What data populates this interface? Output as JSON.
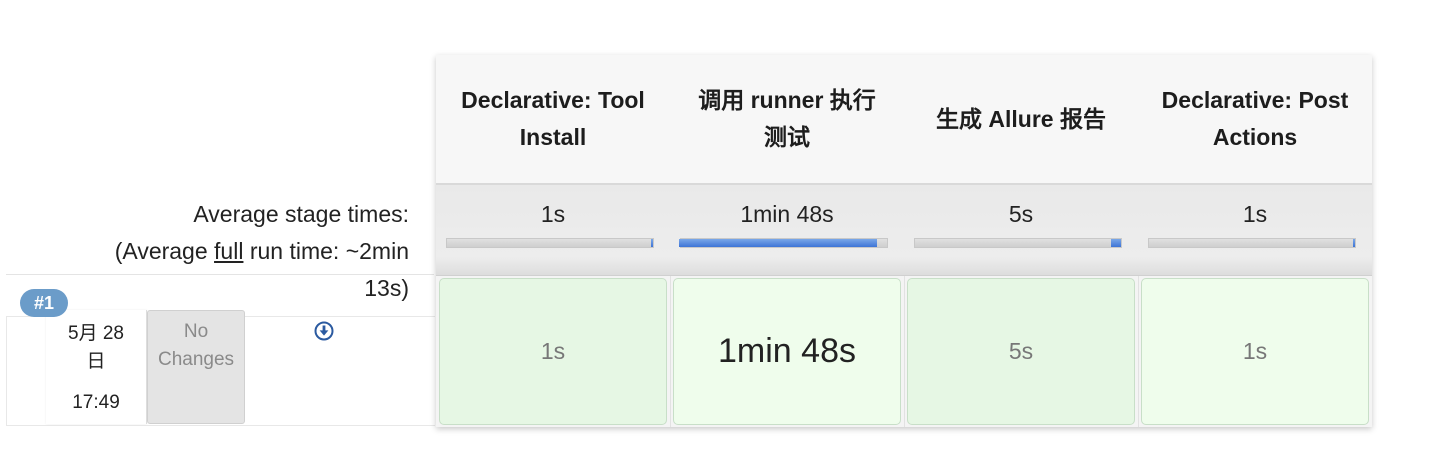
{
  "summary": {
    "line1": "Average stage times:",
    "line2_prefix": "(Average ",
    "line2_full": "full",
    "line2_suffix": " run time: ~2min",
    "line3": "13s)"
  },
  "build": {
    "number": "#1",
    "date_line1": "5月 28",
    "date_line2": "日",
    "time": "17:49",
    "changes_line1": "No",
    "changes_line2": "Changes",
    "download_icon": "download-circle-icon"
  },
  "stages": [
    {
      "name": "Declarative: Tool Install",
      "avg_time": "1s",
      "run_time": "1s",
      "bar_fraction": 0.01
    },
    {
      "name": "调用 runner 执行测试",
      "avg_time": "1min 48s",
      "run_time": "1min 48s",
      "bar_fraction": 0.96
    },
    {
      "name": "生成 Allure 报告",
      "avg_time": "5s",
      "run_time": "5s",
      "bar_fraction": 0.05
    },
    {
      "name": "Declarative: Post Actions",
      "avg_time": "1s",
      "run_time": "1s",
      "bar_fraction": 0.01
    }
  ],
  "colors": {
    "badge": "#6b9cc9",
    "bar_fill": "#3d74d6",
    "success_cell": "#e6f7e4"
  }
}
